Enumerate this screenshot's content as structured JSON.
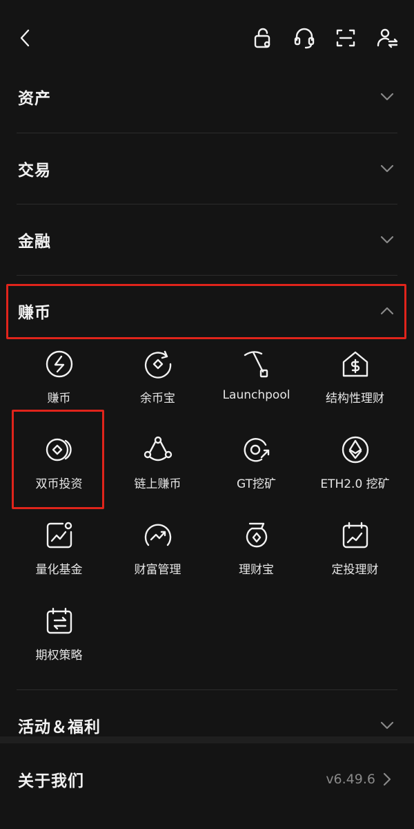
{
  "header": {
    "icons": [
      "back-icon",
      "lock-icon",
      "headset-icon",
      "scan-icon",
      "user-switch-icon"
    ]
  },
  "sections": {
    "assets": {
      "title": "资产"
    },
    "trade": {
      "title": "交易"
    },
    "finance": {
      "title": "金融"
    },
    "earn": {
      "title": "赚币",
      "expanded": true
    },
    "events": {
      "title": "活动＆福利"
    }
  },
  "earn_items": [
    {
      "label": "赚币",
      "icon": "earn-coin-icon"
    },
    {
      "label": "余币宝",
      "icon": "yubibao-icon"
    },
    {
      "label": "Launchpool",
      "icon": "pickaxe-icon"
    },
    {
      "label": "结构性理财",
      "icon": "house-dollar-icon"
    },
    {
      "label": "双币投资",
      "icon": "dual-coin-icon"
    },
    {
      "label": "链上赚币",
      "icon": "chain-network-icon"
    },
    {
      "label": "GT挖矿",
      "icon": "gt-mining-icon"
    },
    {
      "label": "ETH2.0 挖矿",
      "icon": "ethereum-icon"
    },
    {
      "label": "量化基金",
      "icon": "quant-chart-icon"
    },
    {
      "label": "财富管理",
      "icon": "wealth-gauge-icon"
    },
    {
      "label": "理财宝",
      "icon": "licaibao-pot-icon"
    },
    {
      "label": "定投理财",
      "icon": "calendar-chart-icon"
    },
    {
      "label": "期权策略",
      "icon": "calendar-swap-icon"
    }
  ],
  "about": {
    "title": "关于我们",
    "version": "v6.49.6"
  },
  "colors": {
    "background": "#141414",
    "highlight": "#e0241b",
    "muted": "#8a8a8a"
  }
}
